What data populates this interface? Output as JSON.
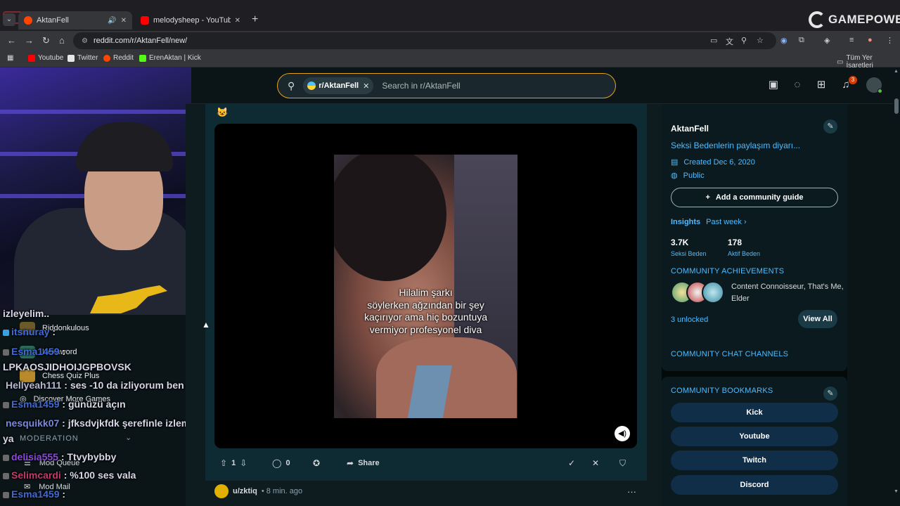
{
  "browser": {
    "tabs": [
      {
        "title": "AktanFell",
        "active": true
      },
      {
        "title": "melodysheep - YouTube",
        "active": false
      }
    ],
    "url": "reddit.com/r/AktanFell/new/",
    "bookmarks": [
      "Youtube",
      "Twitter",
      "Reddit",
      "ErenAktan | Kick"
    ],
    "all_bookmarks": "Tüm Yer İşaretleri",
    "brand_overlay": "GAMEPOWER"
  },
  "reddit": {
    "search": {
      "chip": "r/AktanFell",
      "placeholder": "Search in r/AktanFell"
    },
    "notifications_count": "3",
    "post": {
      "emoji": "😺",
      "caption_lines": [
        "Hilalim şarkı",
        "söylerken ağzından bir şey",
        "kaçırıyor ama hiç bozuntuya",
        "vermiyor profesyonel diva"
      ],
      "votes": "1",
      "comments": "0",
      "share_label": "Share"
    },
    "next_post": {
      "user": "u/zktiq",
      "time": "• 8 min. ago"
    }
  },
  "sidebar": {
    "community_name": "AktanFell",
    "description": "Seksi Bedenlerin paylaşım diyarı...",
    "created": "Created Dec 6, 2020",
    "visibility": "Public",
    "guide_button": "Add a community guide",
    "insights_label": "Insights",
    "insights_period": "Past week",
    "stats": [
      {
        "value": "3.7K",
        "label": "Seksi Beden"
      },
      {
        "value": "178",
        "label": "Aktif Beden"
      }
    ],
    "achievements_header": "COMMUNITY ACHIEVEMENTS",
    "achievements_text": "Content Connoisseur, That's Me, Elder",
    "unlocked": "3 unlocked",
    "view_all": "View All",
    "chat_channels_header": "COMMUNITY CHAT CHANNELS",
    "bookmarks_header": "COMMUNITY BOOKMARKS",
    "bookmarks": [
      "Kick",
      "Youtube",
      "Twitch",
      "Discord"
    ]
  },
  "left_nav": {
    "recent": [
      "Riddonkulous",
      "Hexaword",
      "Chess Quiz Plus",
      "Discover More Games"
    ],
    "moderation_header": "MODERATION",
    "mod_items": [
      "Mod Queue",
      "Mod Mail"
    ]
  },
  "chat": [
    {
      "user": "",
      "text": "izleyelim..",
      "color": "#d7d7e8"
    },
    {
      "user": "itsnuray",
      "text": " :",
      "color": "#3f6ad8"
    },
    {
      "user": "Esma1459",
      "text": " :",
      "color": "#3f6ad8"
    },
    {
      "user": "",
      "text": "LPKAOSJIDHOIJGPBOVSK",
      "color": "#d7d7e8"
    },
    {
      "user": "Hellyeah111",
      "text": " : ses -10 da izliyorum ben",
      "color": "#b8b8d0"
    },
    {
      "user": "Esma1459",
      "text": " : günüzü açın",
      "color": "#3f6ad8"
    },
    {
      "user": "nesquikk07",
      "text": " : jfksdvjkfdk şerefinle izleme",
      "color": "#7a8ad8"
    },
    {
      "user": "",
      "text": "ya",
      "color": "#d7d7e8"
    },
    {
      "user": "delisia555",
      "text": " : Ttvybybby",
      "color": "#8a4ad8"
    },
    {
      "user": "Selimcardi",
      "text": " : %100 ses vala",
      "color": "#c03a6a"
    },
    {
      "user": "Esma1459",
      "text": " :",
      "color": "#3f6ad8"
    }
  ]
}
